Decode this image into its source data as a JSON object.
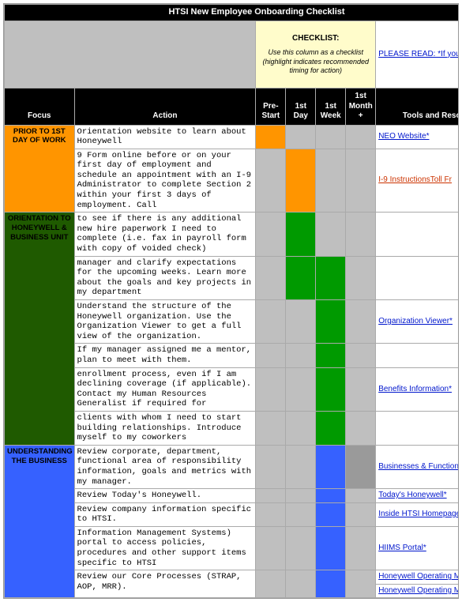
{
  "title": "HTSI New Employee Onboarding Checklist",
  "checklist_box": {
    "title": "CHECKLIST:",
    "subtitle": "Use this column as a checklist (highlight indicates recommended timing for action)"
  },
  "please_read": "PLEASE READ: *If you are not",
  "columns": {
    "focus": "Focus",
    "action": "Action",
    "prestart": "Pre-Start",
    "day1": "1st Day",
    "week1": "1st Week",
    "month1": "1st Month +",
    "tools": "Tools and Resources"
  },
  "sections": {
    "s1": "PRIOR TO 1ST DAY OF WORK",
    "s2": "ORIENTATION TO HONEYWELL & BUSINESS UNIT",
    "s3": "UNDERSTANDING THE BUSINESS"
  },
  "rows": {
    "r1": {
      "action": "Orientation website to learn about Honeywell",
      "res": "NEO Website*"
    },
    "r2": {
      "action": "9 Form online before or on your first day of employment and schedule an appointment with an I-9 Administrator to complete Section 2 within your first 3 days of employment. Call",
      "res": "I-9 InstructionsToll Fr"
    },
    "r3": {
      "action": "to see if there is any additional new hire paperwork I need to complete (i.e. fax in payroll form with copy of voided check)"
    },
    "r4": {
      "action": "manager and clarify expectations for the upcoming weeks. Learn more about the goals and key projects in my department"
    },
    "r5": {
      "action": "Understand the structure of the Honeywell organization. Use the Organization Viewer to get a full view of the organization.",
      "res": "Organization Viewer*"
    },
    "r6": {
      "action": "If my manager assigned me a mentor, plan to meet with them."
    },
    "r7": {
      "action": "enrollment process, even if I am declining coverage (if applicable). Contact my Human Resources Generalist if required for",
      "res": "Benefits Information*"
    },
    "r8": {
      "action": "clients with whom I need to start building relationships.  Introduce myself to my coworkers"
    },
    "r9": {
      "action": "Review corporate, department, functional area of responsibility information, goals and metrics with my manager.",
      "res": "Businesses & Functions Site*"
    },
    "r10": {
      "action": "Review Today's Honeywell.",
      "res": "Today's Honeywell*"
    },
    "r11": {
      "action": "Review company information specific to HTSI.",
      "res": "Inside HTSI Homepage*"
    },
    "r12": {
      "action": "Information Management Systems) portal to access policies, procedures and other support items specific to HTSI",
      "res": "HIIMS Portal*"
    },
    "r13": {
      "action": "Review our Core Processes (STRAP, AOP, MRR).",
      "res1": "Honeywell Operating Model*",
      "res2": "Honeywell Operating Model Vid"
    }
  }
}
